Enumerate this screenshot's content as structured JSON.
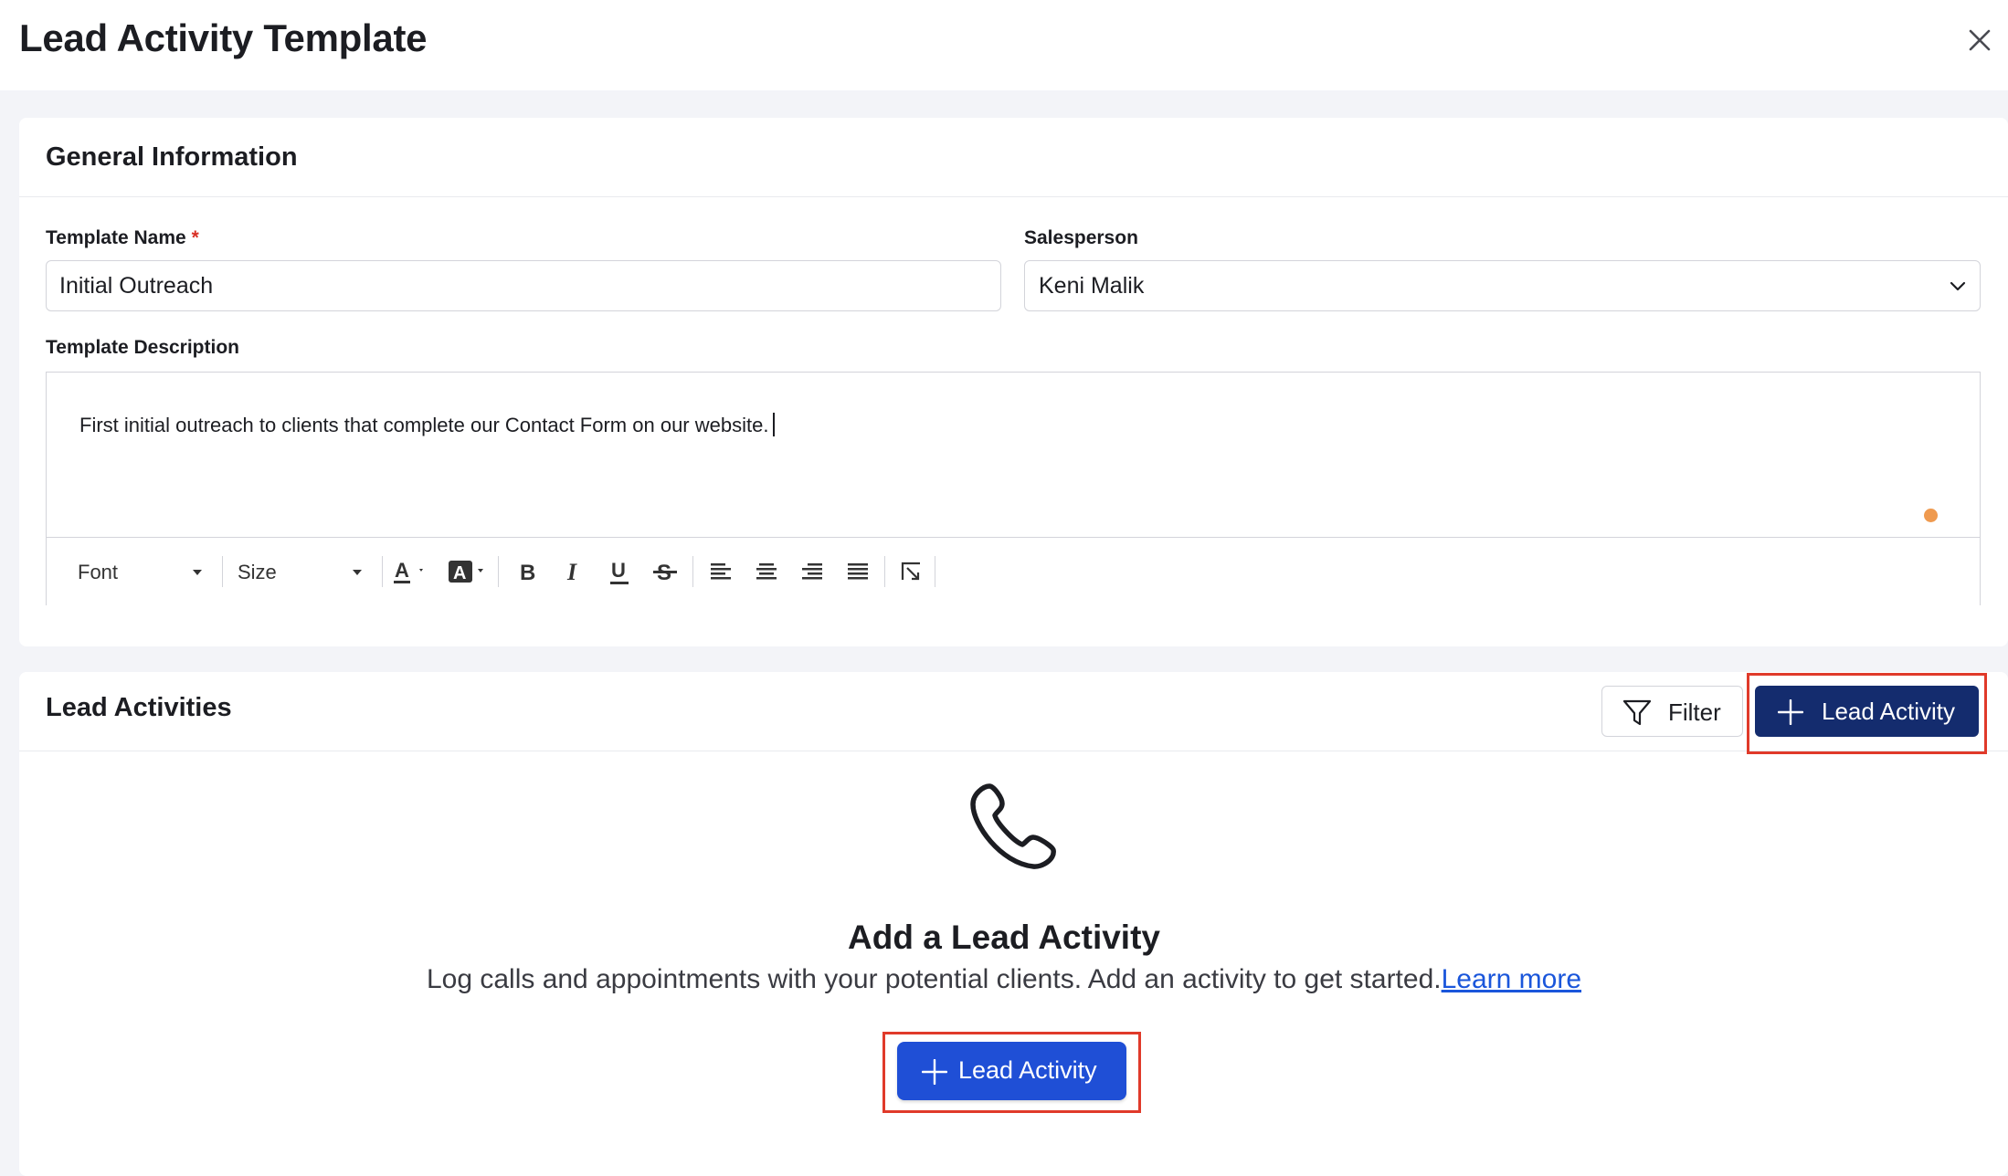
{
  "window": {
    "title": "Lead Activity Template",
    "close_icon": "close-icon"
  },
  "general": {
    "title": "General Information",
    "template_name_label": "Template Name",
    "required_marker": "*",
    "template_name_value": "Initial Outreach",
    "salesperson_label": "Salesperson",
    "salesperson_value": "Keni Malik",
    "description_label": "Template Description",
    "description_value": "First initial outreach to clients that complete our Contact Form on our website.",
    "toolbar": {
      "font_label": "Font",
      "size_label": "Size",
      "icons": [
        "text-color-icon",
        "highlight-color-icon",
        "bold-icon",
        "italic-icon",
        "underline-icon",
        "strikethrough-icon",
        "align-left-icon",
        "align-center-icon",
        "align-right-icon",
        "align-justify-icon",
        "clear-format-icon"
      ]
    }
  },
  "activities": {
    "title": "Lead Activities",
    "filter_label": "Filter",
    "add_label": "Lead Activity",
    "empty_icon": "phone-icon",
    "empty_title": "Add a Lead Activity",
    "empty_description": "Log calls and appointments with your potential clients. Add an activity to get started.",
    "learn_more": "Learn more",
    "center_add_label": "Lead Activity"
  },
  "colors": {
    "primary_dark": "#142c6e",
    "primary": "#1f4fd6",
    "highlight": "#e03a2a",
    "required": "#d93025",
    "link": "#1a56db"
  }
}
